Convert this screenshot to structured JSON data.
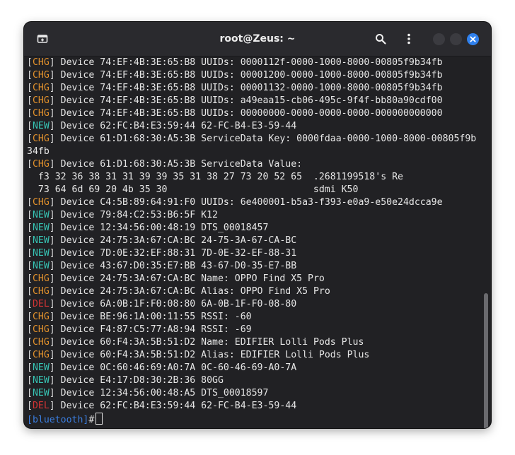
{
  "window": {
    "title": "root@Zeus: ~"
  },
  "icons": {
    "new_tab": "new-tab-icon",
    "search": "search-icon",
    "menu": "kebab-menu-icon",
    "close": "close-icon"
  },
  "colors": {
    "chg": "#e0902c",
    "new": "#37c4b4",
    "del": "#d23434",
    "prompt": "#3b7ee0",
    "close_button": "#2f80ed"
  },
  "terminal": {
    "lines": [
      {
        "tag": "CHG",
        "text": " Device 74:EF:4B:3E:65:B8 UUIDs: 0000112f-0000-1000-8000-00805f9b34fb"
      },
      {
        "tag": "CHG",
        "text": " Device 74:EF:4B:3E:65:B8 UUIDs: 00001200-0000-1000-8000-00805f9b34fb"
      },
      {
        "tag": "CHG",
        "text": " Device 74:EF:4B:3E:65:B8 UUIDs: 00001132-0000-1000-8000-00805f9b34fb"
      },
      {
        "tag": "CHG",
        "text": " Device 74:EF:4B:3E:65:B8 UUIDs: a49eaa15-cb06-495c-9f4f-bb80a90cdf00"
      },
      {
        "tag": "CHG",
        "text": " Device 74:EF:4B:3E:65:B8 UUIDs: 00000000-0000-0000-0000-000000000000"
      },
      {
        "tag": "NEW",
        "text": " Device 62:FC:B4:E3:59:44 62-FC-B4-E3-59-44"
      },
      {
        "tag": "CHG",
        "text": " Device 61:D1:68:30:A5:3B ServiceData Key: 0000fdaa-0000-1000-8000-00805f9b"
      },
      {
        "tag": "",
        "text": "34fb"
      },
      {
        "tag": "CHG",
        "text": " Device 61:D1:68:30:A5:3B ServiceData Value:"
      },
      {
        "tag": "",
        "text": "  f3 32 36 38 31 31 39 39 35 31 38 27 73 20 52 65  .2681199518's Re"
      },
      {
        "tag": "",
        "text": "  73 64 6d 69 20 4b 35 30                          sdmi K50"
      },
      {
        "tag": "CHG",
        "text": " Device C4:5B:89:64:91:F0 UUIDs: 6e400001-b5a3-f393-e0a9-e50e24dcca9e"
      },
      {
        "tag": "NEW",
        "text": " Device 79:84:C2:53:B6:5F K12"
      },
      {
        "tag": "NEW",
        "text": " Device 12:34:56:00:48:19 DTS_00018457"
      },
      {
        "tag": "NEW",
        "text": " Device 24:75:3A:67:CA:BC 24-75-3A-67-CA-BC"
      },
      {
        "tag": "NEW",
        "text": " Device 7D:0E:32:EF:88:31 7D-0E-32-EF-88-31"
      },
      {
        "tag": "NEW",
        "text": " Device 43:67:D0:35:E7:BB 43-67-D0-35-E7-BB"
      },
      {
        "tag": "CHG",
        "text": " Device 24:75:3A:67:CA:BC Name: OPPO Find X5 Pro"
      },
      {
        "tag": "CHG",
        "text": " Device 24:75:3A:67:CA:BC Alias: OPPO Find X5 Pro"
      },
      {
        "tag": "DEL",
        "text": " Device 6A:0B:1F:F0:08:80 6A-0B-1F-F0-08-80"
      },
      {
        "tag": "CHG",
        "text": " Device BE:96:1A:00:11:55 RSSI: -60"
      },
      {
        "tag": "CHG",
        "text": " Device F4:87:C5:77:A8:94 RSSI: -69"
      },
      {
        "tag": "CHG",
        "text": " Device 60:F4:3A:5B:51:D2 Name: EDIFIER Lolli Pods Plus"
      },
      {
        "tag": "CHG",
        "text": " Device 60:F4:3A:5B:51:D2 Alias: EDIFIER Lolli Pods Plus"
      },
      {
        "tag": "NEW",
        "text": " Device 0C:60:46:69:A0:7A 0C-60-46-69-A0-7A"
      },
      {
        "tag": "NEW",
        "text": " Device E4:17:D8:30:2B:36 80GG"
      },
      {
        "tag": "NEW",
        "text": " Device 12:34:56:00:48:A5 DTS_00018597"
      },
      {
        "tag": "DEL",
        "text": " Device 62:FC:B4:E3:59:44 62-FC-B4-E3-59-44"
      }
    ],
    "prompt_label": "bluetooth",
    "prompt_symbol": "#"
  }
}
